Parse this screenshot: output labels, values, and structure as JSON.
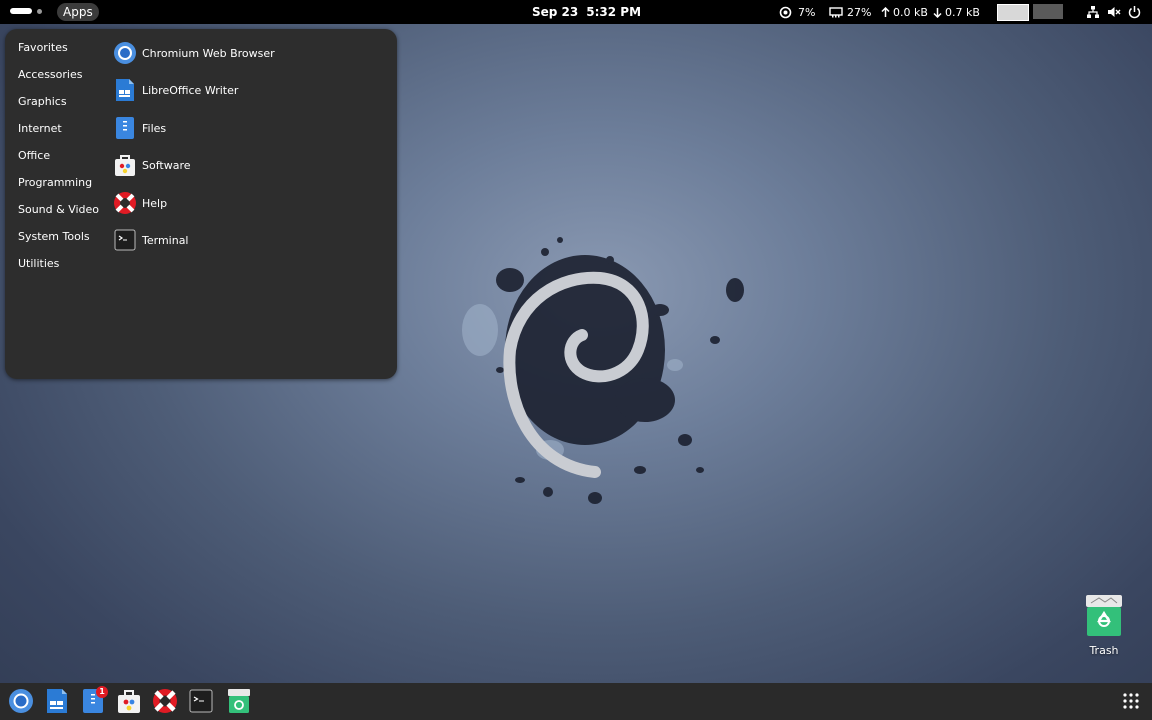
{
  "topbar": {
    "apps_label": "Apps",
    "date": "Sep 23",
    "time": "5:32 PM",
    "cpu": "7%",
    "memory": "27%",
    "net_up": "0.0 kB",
    "net_down": "0.7 kB",
    "icons": [
      "cpu-icon",
      "memory-icon",
      "upload-arrow-icon",
      "download-arrow-icon",
      "network-icon",
      "volume-muted-icon",
      "power-icon"
    ]
  },
  "menu": {
    "categories": [
      "Favorites",
      "Accessories",
      "Graphics",
      "Internet",
      "Office",
      "Programming",
      "Sound & Video",
      "System Tools",
      "Utilities"
    ],
    "apps": [
      {
        "label": "Chromium Web Browser",
        "icon": "chromium-icon"
      },
      {
        "label": "LibreOffice Writer",
        "icon": "libreoffice-writer-icon"
      },
      {
        "label": "Files",
        "icon": "files-icon"
      },
      {
        "label": "Software",
        "icon": "software-icon"
      },
      {
        "label": "Help",
        "icon": "help-lifebuoy-icon"
      },
      {
        "label": "Terminal",
        "icon": "terminal-icon"
      }
    ]
  },
  "dash": {
    "apps": [
      "chromium-icon",
      "libreoffice-writer-icon",
      "files-icon",
      "software-icon",
      "help-lifebuoy-icon",
      "terminal-icon",
      "trash-icon"
    ],
    "files_badge": "1"
  },
  "desktop": {
    "trash_label": "Trash"
  },
  "colors": {
    "topbar": "#000000",
    "menu_bg": "#2d2d2d",
    "dash_bg": "#2a2a2a",
    "accent_blue": "#3584e4",
    "badge_red": "#e01b24"
  }
}
